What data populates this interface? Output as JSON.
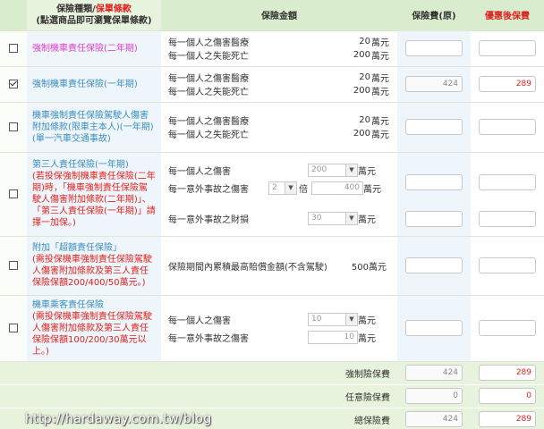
{
  "header": {
    "col_type": "保險種類/",
    "col_type_link": "保單條款",
    "col_type_note": "(點選商品即可瀏覽保單條款)",
    "col_amount": "保險金額",
    "col_premium": "保險費(原)",
    "col_discount": "優惠後保費"
  },
  "rows": [
    {
      "checked": false,
      "title": "強制機車責任保險(二年期)",
      "l1": "每一個人之傷害醫療",
      "v1": "20",
      "l2": "每一個人之失能死亡",
      "v2": "200",
      "unit": "萬元",
      "orig": "",
      "disc": ""
    },
    {
      "checked": true,
      "title": "強制機車責任保險(一年期)",
      "l1": "每一個人之傷害醫療",
      "v1": "20",
      "l2": "每一個人之失能死亡",
      "v2": "200",
      "unit": "萬元",
      "orig": "424",
      "disc": "289"
    },
    {
      "checked": false,
      "title": "機車強制責任保險駕駛人傷害附加條款(限車主本人)(一年期)(單一汽車交通事故)",
      "l1": "每一個人之傷害醫療",
      "v1": "20",
      "l2": "每一個人之失能死亡",
      "v2": "200",
      "unit": "萬元",
      "orig": "",
      "disc": ""
    }
  ],
  "third_party": {
    "title": "第三人責任保險(一年期)",
    "note": "(若投保強制機車責任保險(二年期)時，「機車強制責任保險駕駛人傷害附加條款(二年期)」、「第三人責任保險(一年期)」請擇一加保。)",
    "injury_label": "每一個人之傷害",
    "injury_value": "200",
    "unit": "萬元",
    "accident_label": "每一意外事故之傷害",
    "multiplier": "2",
    "times": "倍",
    "accident_value": "400",
    "property_label": "每一意外事故之財損",
    "property_value": "30"
  },
  "excess": {
    "title": "附加「超額責任保險」",
    "note": "(需投保機車強制責任保險駕駛人傷害附加條款及第三人責任保險保額200/400/50萬元。)",
    "label": "保險期間內累積最高賠償金額(不含駕駛)",
    "value": "500萬元"
  },
  "passenger": {
    "title": "機車乘客責任保險",
    "note": "(需投保機車強制責任保險駕駛人傷害附加條款及第三人責任保險保額100/200/30萬元以上。)",
    "l1": "每一個人之傷害",
    "v1": "10",
    "l2": "每一意外事故之傷害",
    "v2": "10",
    "unit": "萬元"
  },
  "summary": {
    "compulsory_label": "強制險保費",
    "compulsory_orig": "424",
    "compulsory_disc": "289",
    "optional_label": "任意險保費",
    "optional_orig": "0",
    "optional_disc": "0",
    "total_label": "總保險費",
    "total_orig": "424",
    "total_disc": "289"
  },
  "watermark": "http://hardaway.com.tw/blog",
  "icons": {
    "checkbox": "checkbox-icon",
    "dropdown": "chevron-down-icon"
  },
  "colors": {
    "header_bg": "#d9eccd",
    "link": "#3c8dbc",
    "red": "#e0221f",
    "pink": "#e040c8"
  }
}
